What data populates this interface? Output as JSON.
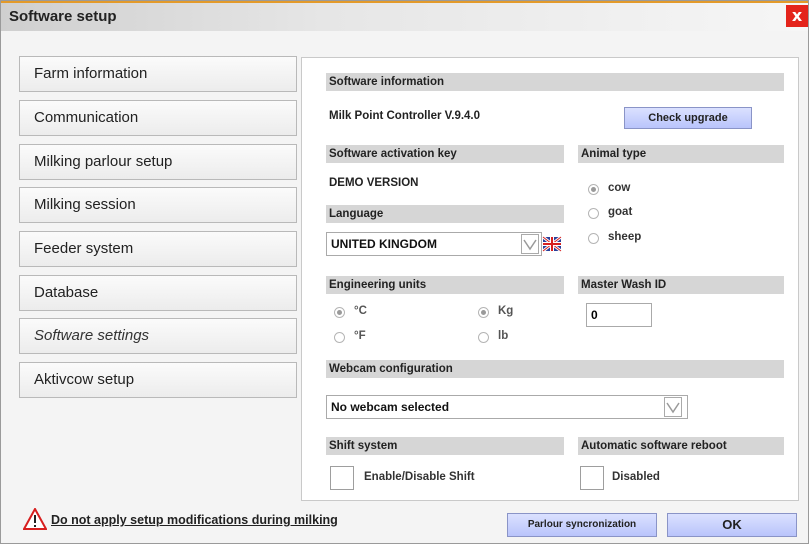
{
  "window": {
    "title": "Software setup",
    "close_glyph": "x"
  },
  "sidebar": {
    "items": [
      {
        "label": "Farm information"
      },
      {
        "label": "Communication"
      },
      {
        "label": "Milking parlour setup"
      },
      {
        "label": "Milking session"
      },
      {
        "label": "Feeder system"
      },
      {
        "label": "Database"
      },
      {
        "label": "Software settings",
        "selected": true
      },
      {
        "label": "Aktivcow setup"
      }
    ]
  },
  "software_info": {
    "header": "Software information",
    "version": "Milk Point Controller V.9.4.0",
    "check_upgrade": "Check upgrade"
  },
  "activation": {
    "header": "Software activation key",
    "value": "DEMO VERSION"
  },
  "language": {
    "header": "Language",
    "selected": "UNITED KINGDOM"
  },
  "animal_type": {
    "header": "Animal type",
    "options": [
      "cow",
      "goat",
      "sheep"
    ],
    "selected": "cow"
  },
  "engineering_units": {
    "header": "Engineering units",
    "temperature": [
      "°C",
      "°F"
    ],
    "weight": [
      "Kg",
      "lb"
    ],
    "selected_temperature": "°C",
    "selected_weight": "Kg"
  },
  "master_wash": {
    "header": "Master Wash ID",
    "value": "0"
  },
  "webcam": {
    "header": "Webcam configuration",
    "selected": "No webcam selected"
  },
  "shift": {
    "header": "Shift system",
    "label": "Enable/Disable Shift",
    "checked": false
  },
  "reboot": {
    "header": "Automatic software reboot",
    "label": "Disabled",
    "checked": false
  },
  "footer": {
    "warning": "Do not apply setup modifications during milking",
    "sync_button": "Parlour syncronization",
    "ok_button": "OK"
  },
  "icons": {
    "close": "close-icon",
    "flag": "uk-flag-icon",
    "warning": "warning-triangle-icon",
    "dropdown": "chevron-down-icon"
  },
  "colors": {
    "title_accent": "#e39a2a",
    "close_red": "#e4241b",
    "button_blue": "#c3ccfb",
    "header_gray": "#d6d6d6"
  }
}
